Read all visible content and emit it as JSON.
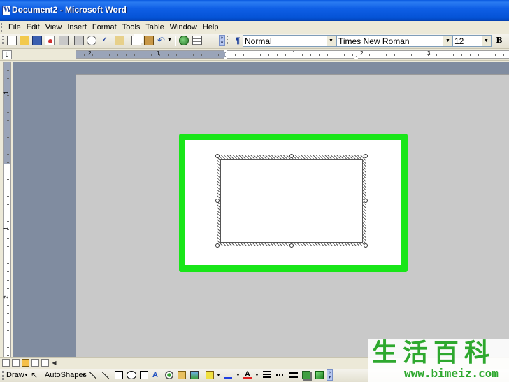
{
  "window": {
    "title": "Document2 - Microsoft Word"
  },
  "menubar": {
    "items": [
      {
        "label": "File",
        "name": "menu-file"
      },
      {
        "label": "Edit",
        "name": "menu-edit"
      },
      {
        "label": "View",
        "name": "menu-view"
      },
      {
        "label": "Insert",
        "name": "menu-insert"
      },
      {
        "label": "Format",
        "name": "menu-format"
      },
      {
        "label": "Tools",
        "name": "menu-tools"
      },
      {
        "label": "Table",
        "name": "menu-table"
      },
      {
        "label": "Window",
        "name": "menu-window"
      },
      {
        "label": "Help",
        "name": "menu-help"
      }
    ]
  },
  "formatting": {
    "style": "Normal",
    "font": "Times New Roman",
    "size": "12",
    "bold_label": "B"
  },
  "ruler": {
    "horizontal_numbers": [
      "2",
      "1",
      "1",
      "2",
      "3"
    ],
    "vertical_numbers": [
      "1",
      "1",
      "2"
    ]
  },
  "drawing_toolbar": {
    "draw_label": "Draw",
    "autoshapes_label": "AutoShapes",
    "font_color_glyph": "A"
  },
  "watermark": {
    "chars": "生活百科",
    "url": "www.bimeiz.com"
  }
}
